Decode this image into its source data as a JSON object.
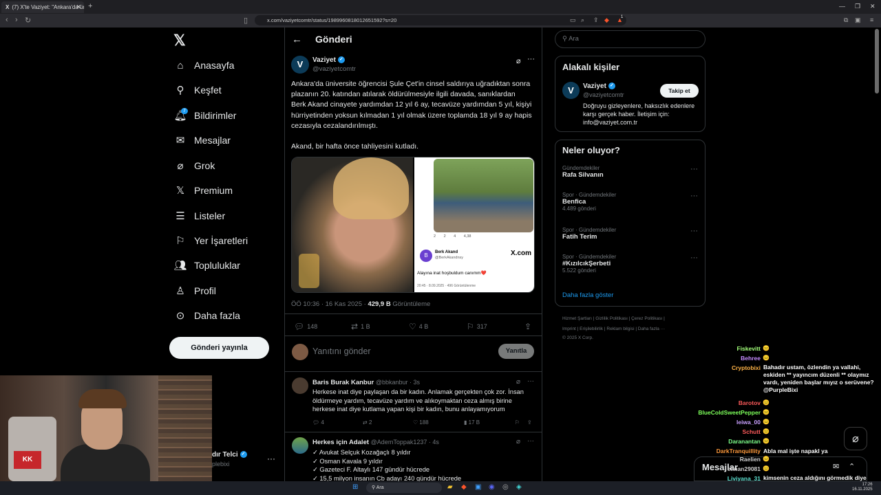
{
  "browser": {
    "tab_title": "(7) X'te Vaziyet: \"Ankara'da üniv...",
    "tab_x_glyph": "X",
    "url": "x.com/vaziyetcomtr/status/1989960818012651592?s=20",
    "brand_icon": "brave-lion-icon",
    "notif_count": "1"
  },
  "nav": {
    "items": [
      {
        "label": "Anasayfa",
        "icon": "home-icon"
      },
      {
        "label": "Keşfet",
        "icon": "search-icon"
      },
      {
        "label": "Bildirimler",
        "icon": "bell-icon",
        "badge": "7"
      },
      {
        "label": "Mesajlar",
        "icon": "mail-icon"
      },
      {
        "label": "Grok",
        "icon": "grok-icon"
      },
      {
        "label": "Premium",
        "icon": "x-icon"
      },
      {
        "label": "Listeler",
        "icon": "list-icon"
      },
      {
        "label": "Yer İşaretleri",
        "icon": "bookmark-icon"
      },
      {
        "label": "Topluluklar",
        "icon": "people-icon"
      },
      {
        "label": "Profil",
        "icon": "person-icon"
      },
      {
        "label": "Daha fazla",
        "icon": "more-circle-icon"
      }
    ],
    "post_button": "Gönderi yayınla",
    "account_name": "dır Telci",
    "account_handle": "plebixi"
  },
  "header": {
    "title": "Gönderi"
  },
  "tweet": {
    "author_name": "Vaziyet",
    "author_handle": "@vaziyetcomtr",
    "avatar_letter": "V",
    "paragraph1": "Ankara'da üniversite öğrencisi Şule Çet'in cinsel saldırıya uğradıktan sonra plazanın 20. katından atılarak öldürülmesiyle ilgili davada, sanıklardan Berk Akand cinayete yardımdan 12 yıl 6 ay, tecavüze yardımdan 5 yıl, kişiyi hürriyetinden yoksun kılmadan 1 yıl olmak üzere toplamda 18 yıl 9 ay hapis cezasıyla cezalandırılmıştı.",
    "paragraph2": "Akand, bir hafta önce tahliyesini kutladı.",
    "time": "ÖÖ 10:36 · 16 Kas 2025 · ",
    "views_count": "429,9 B",
    "views_label": " Görüntüleme",
    "replies": "148",
    "retweets": "1 B",
    "likes": "4 B",
    "bookmarks": "317",
    "embedded": {
      "stats": "2   2   4   4,38",
      "avatar_letter": "B",
      "name": "Berk Akand",
      "handle": "@BerkAkandnsy",
      "brand": "X.com",
      "text": "Alayına inat hoşbuldum canımm",
      "heart": "❤️",
      "meta": "20:45 · 8.09.2025 · 496 Görüntülenme"
    }
  },
  "reply_box": {
    "placeholder": "Yanıtını gönder",
    "button": "Yanıtla"
  },
  "comments": [
    {
      "name": "Baris Burak Kanbur",
      "meta": "@bbkanbur · 3s",
      "text": "Herkese inat diye paylaşan da bir kadın. Anlamak gerçekten çok zor. İnsan öldürmeye yardım, tecavüze yardım ve alıkoymaktan ceza almış birine herkese inat diye kutlama yapan kişi bir kadın, bunu anlayamıyorum",
      "replies": "4",
      "retweets": "2",
      "likes": "188",
      "views": "17 B"
    },
    {
      "name": "Herkes için Adalet",
      "meta": "@AdemTopрak1237 · 4s",
      "lines": [
        "✓ Avukat Selçuk Kozağaçlı 8 yıldır",
        "✓ Osman Kavala 9 yıldır",
        "✓ Gazeteci F. Altaylı 147 gündür hücrede",
        "✓ 15,5 milyon insanın Cb adayı 240 gündür hücrede"
      ]
    }
  ],
  "search": {
    "placeholder": "Ara"
  },
  "related": {
    "title": "Alakalı kişiler",
    "name": "Vaziyet",
    "handle": "@vaziyetcomtr",
    "follow": "Takip et",
    "bio": "Doğruyu gizleyenlere, haksızlık edenlere karşı gerçek haber. İletişim için: info@vaziyet.com.tr"
  },
  "trends": {
    "title": "Neler oluyor?",
    "items": [
      {
        "category": "Gündemdekiler",
        "name": "Rafa Silvanın",
        "count": ""
      },
      {
        "category": "Spor · Gündemdekiler",
        "name": "Benfica",
        "count": "4.489 gönderi"
      },
      {
        "category": "Spor · Gündemdekiler",
        "name": "Fatih Terim",
        "count": ""
      },
      {
        "category": "Spor · Gündemdekiler",
        "name": "#KızılcıkŞerbeti",
        "count": "5.522 gönderi"
      }
    ],
    "show_more": "Daha fazla göster"
  },
  "footer": {
    "line1": "Hizmet Şartları  |  Gizlilik Politikası  |  Çerez Politikası  |",
    "line2": "Imprint  |  Erişilebilirlik  |  Reklam bilgisi  |  Daha fazla ···",
    "line3": "© 2025 X Corp."
  },
  "chat": [
    {
      "user": "Fiskevitt",
      "color": "#a3ff7a",
      "msg": ""
    },
    {
      "user": "Behree",
      "color": "#c58cff",
      "msg": ""
    },
    {
      "user": "Cryptobixi",
      "color": "#ffb347",
      "msg": "Bahadır ustam, özlendin ya vallahi, eskiden ** yayıncım düzenli ** olaymız vardı, yeniden başlar mıyız o serüvene? @PurpleBixi"
    },
    {
      "user": "Barotov",
      "color": "#ff5b5b",
      "msg": ""
    },
    {
      "user": "BlueColdSweetPepper",
      "color": "#7dff5a",
      "msg": ""
    },
    {
      "user": "leiwa_00",
      "color": "#c9a0ff",
      "msg": ""
    },
    {
      "user": "Schutt",
      "color": "#ff5b5b",
      "msg": ""
    },
    {
      "user": "Daranantan",
      "color": "#7dff8a",
      "msg": ""
    },
    {
      "user": "DarkTranquillity",
      "color": "#ff9a3c",
      "msg": "Abla mal işte napakl ya"
    },
    {
      "user": "Raelien",
      "color": "#d0d0d0",
      "msg": ""
    },
    {
      "user": "elman29081",
      "color": "#d0d0d0",
      "msg": ""
    },
    {
      "user": "Liviyana_31",
      "color": "#5ce0d0",
      "msg": "kimsenin ceza aldığını görmedik diye erekte oluyor olabilir miyiz"
    }
  ],
  "messages_drawer": {
    "title": "Mesajlar"
  },
  "taskbar": {
    "search": "Ara",
    "time": "17:26",
    "date": "16.11.2025"
  }
}
